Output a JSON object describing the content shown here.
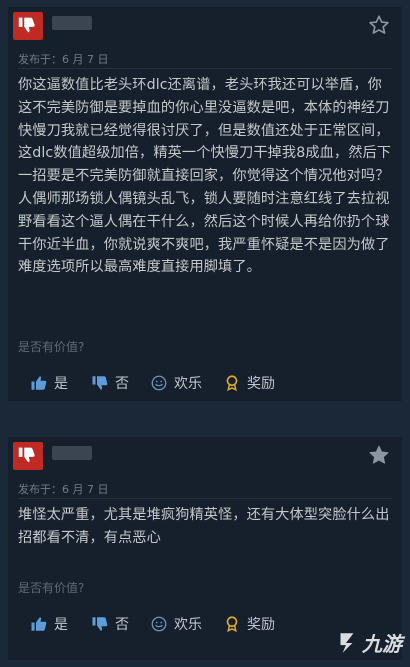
{
  "reviews": [
    {
      "date": "发布于：6 月 7 日",
      "text": "你这逼数值比老头环dlc还离谱，老头环我还可以举盾，你这不完美防御是要掉血的你心里没逼数是吧，本体的神经刀快慢刀我就已经觉得很讨厌了，但是数值还处于正常区间，这dlc数值超级加倍，精英一个快慢刀干掉我8成血，然后下一招要是不完美防御就直接回家，你觉得这个情况他对吗？人偶师那场锁人偶镜头乱飞，锁人要随时注意红线了去拉视野看看这个逼人偶在干什么，然后这个时候人再给你扔个球干你近半血，你就说爽不爽吧，我严重怀疑是不是因为做了难度选项所以最高难度直接用脚填了。",
      "helpful_label": "是否有价值?",
      "votes": {
        "yes": "是",
        "no": "否",
        "funny": "欢乐",
        "award": "奖励"
      }
    },
    {
      "date": "发布于：6 月 7 日",
      "text": "堆怪太严重，尤其是堆疯狗精英怪，还有大体型突脸什么出招都看不清，有点恶心",
      "helpful_label": "是否有价值?",
      "votes": {
        "yes": "是",
        "no": "否",
        "funny": "欢乐",
        "award": "奖励"
      }
    }
  ],
  "watermark": "九游",
  "colors": {
    "avatar_red": "#c02a25",
    "card_bg": "#16202d",
    "page_bg": "#1b2838",
    "award_gold": "#d9a932"
  }
}
